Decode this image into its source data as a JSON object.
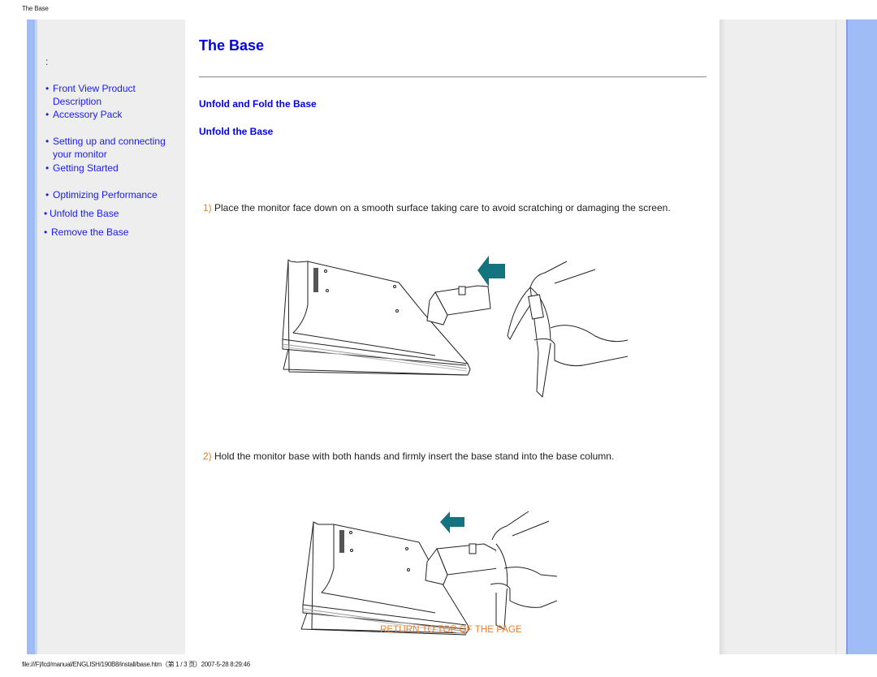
{
  "print_header": "The Base",
  "print_footer": "file:///F|/lcd/manual/ENGLISH/190B8/install/base.htm（第 1 / 3 页）2007-5-28 8:29:46",
  "sidebar": {
    "colon": ":",
    "bullet": "•",
    "items": [
      {
        "label_line1": "Front View Product",
        "label_line2": "Description"
      },
      {
        "label_line1": "Accessory Pack",
        "label_line2": ""
      },
      {
        "label_line1": "Setting up and connecting",
        "label_line2": "your monitor"
      },
      {
        "label_line1": "Getting Started",
        "label_line2": ""
      },
      {
        "label_line1": "Optimizing Performance",
        "label_line2": ""
      },
      {
        "label_line1": "Unfold the Base",
        "label_line2": ""
      },
      {
        "label_line1": "Remove the Base",
        "label_line2": ""
      }
    ]
  },
  "main": {
    "title": "The Base",
    "section_heading": "Unfold and Fold the Base",
    "subsection_heading": "Unfold the Base",
    "steps": [
      {
        "num": "1)",
        "text": "Place the monitor face down on a smooth surface taking care to avoid scratching or damaging the screen.",
        "illustration": "monitor-base-attach-step1"
      },
      {
        "num": "2)",
        "text": "Hold the monitor base with both hands and firmly insert the base stand into the base column.",
        "illustration": "monitor-base-attach-step2"
      }
    ],
    "return_link": "RETURN TO TOP OF THE PAGE"
  },
  "colors": {
    "link_blue": "#0000ee",
    "nav_blue": "#1a1aff",
    "step_number_orange": "#f07a1a",
    "return_link_orange": "#f37b22",
    "arrow_teal": "#137480",
    "stripe_blue": "#9fbcf6",
    "panel_gray": "#eeeeee"
  }
}
